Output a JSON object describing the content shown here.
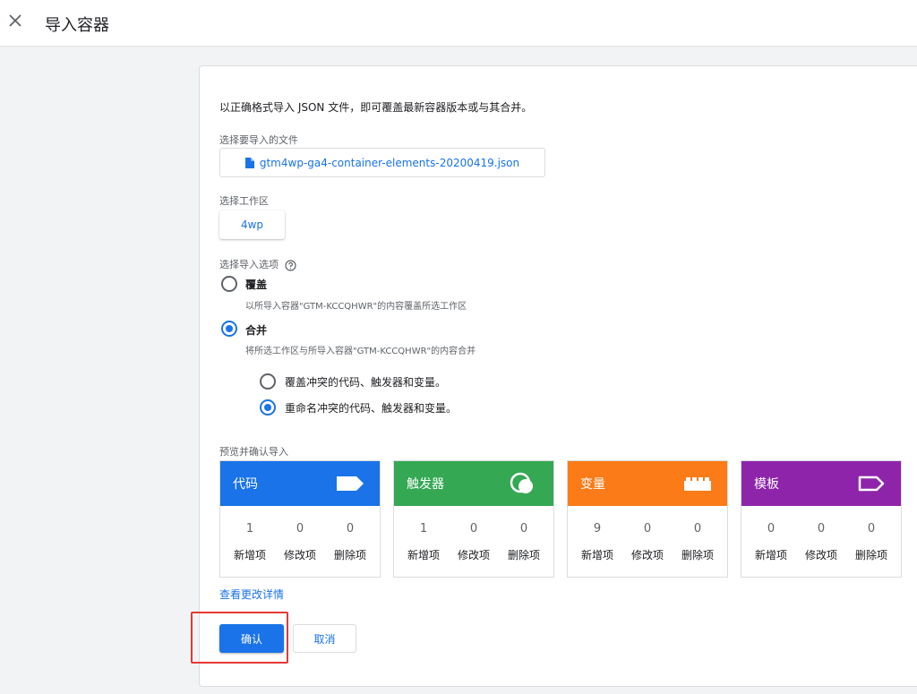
{
  "header": {
    "title": "导入容器"
  },
  "intro": "以正确格式导入 JSON 文件，即可覆盖最新容器版本或与其合并。",
  "file": {
    "label": "选择要导入的文件",
    "name": "gtm4wp-ga4-container-elements-20200419.json"
  },
  "workspace": {
    "label": "选择工作区",
    "value": "4wp"
  },
  "import_options": {
    "label": "选择导入选项",
    "overwrite": {
      "title": "覆盖",
      "desc": "以所导入容器\"GTM-KCCQHWR\"的内容覆盖所选工作区",
      "selected": false
    },
    "merge": {
      "title": "合并",
      "desc": "将所选工作区与所导入容器\"GTM-KCCQHWR\"的内容合并",
      "selected": true
    },
    "sub_options": [
      {
        "label": "覆盖冲突的代码、触发器和变量。",
        "selected": false
      },
      {
        "label": "重命名冲突的代码、触发器和变量。",
        "selected": true
      }
    ]
  },
  "preview": {
    "label": "预览并确认导入",
    "captions": [
      "新增项",
      "修改项",
      "删除项"
    ],
    "cards": [
      {
        "title": "代码",
        "color": "#1a73e8",
        "icon": "tag-icon",
        "counts": [
          "1",
          "0",
          "0"
        ]
      },
      {
        "title": "触发器",
        "color": "#34a853",
        "icon": "trigger-icon",
        "counts": [
          "1",
          "0",
          "0"
        ]
      },
      {
        "title": "变量",
        "color": "#fa7b17",
        "icon": "variable-blocks-icon",
        "counts": [
          "9",
          "0",
          "0"
        ]
      },
      {
        "title": "模板",
        "color": "#8e24aa",
        "icon": "template-tag-icon",
        "counts": [
          "0",
          "0",
          "0"
        ]
      }
    ]
  },
  "details_link": "查看更改详情",
  "buttons": {
    "confirm": "确认",
    "cancel": "取消"
  },
  "highlight_color": "#e53935"
}
